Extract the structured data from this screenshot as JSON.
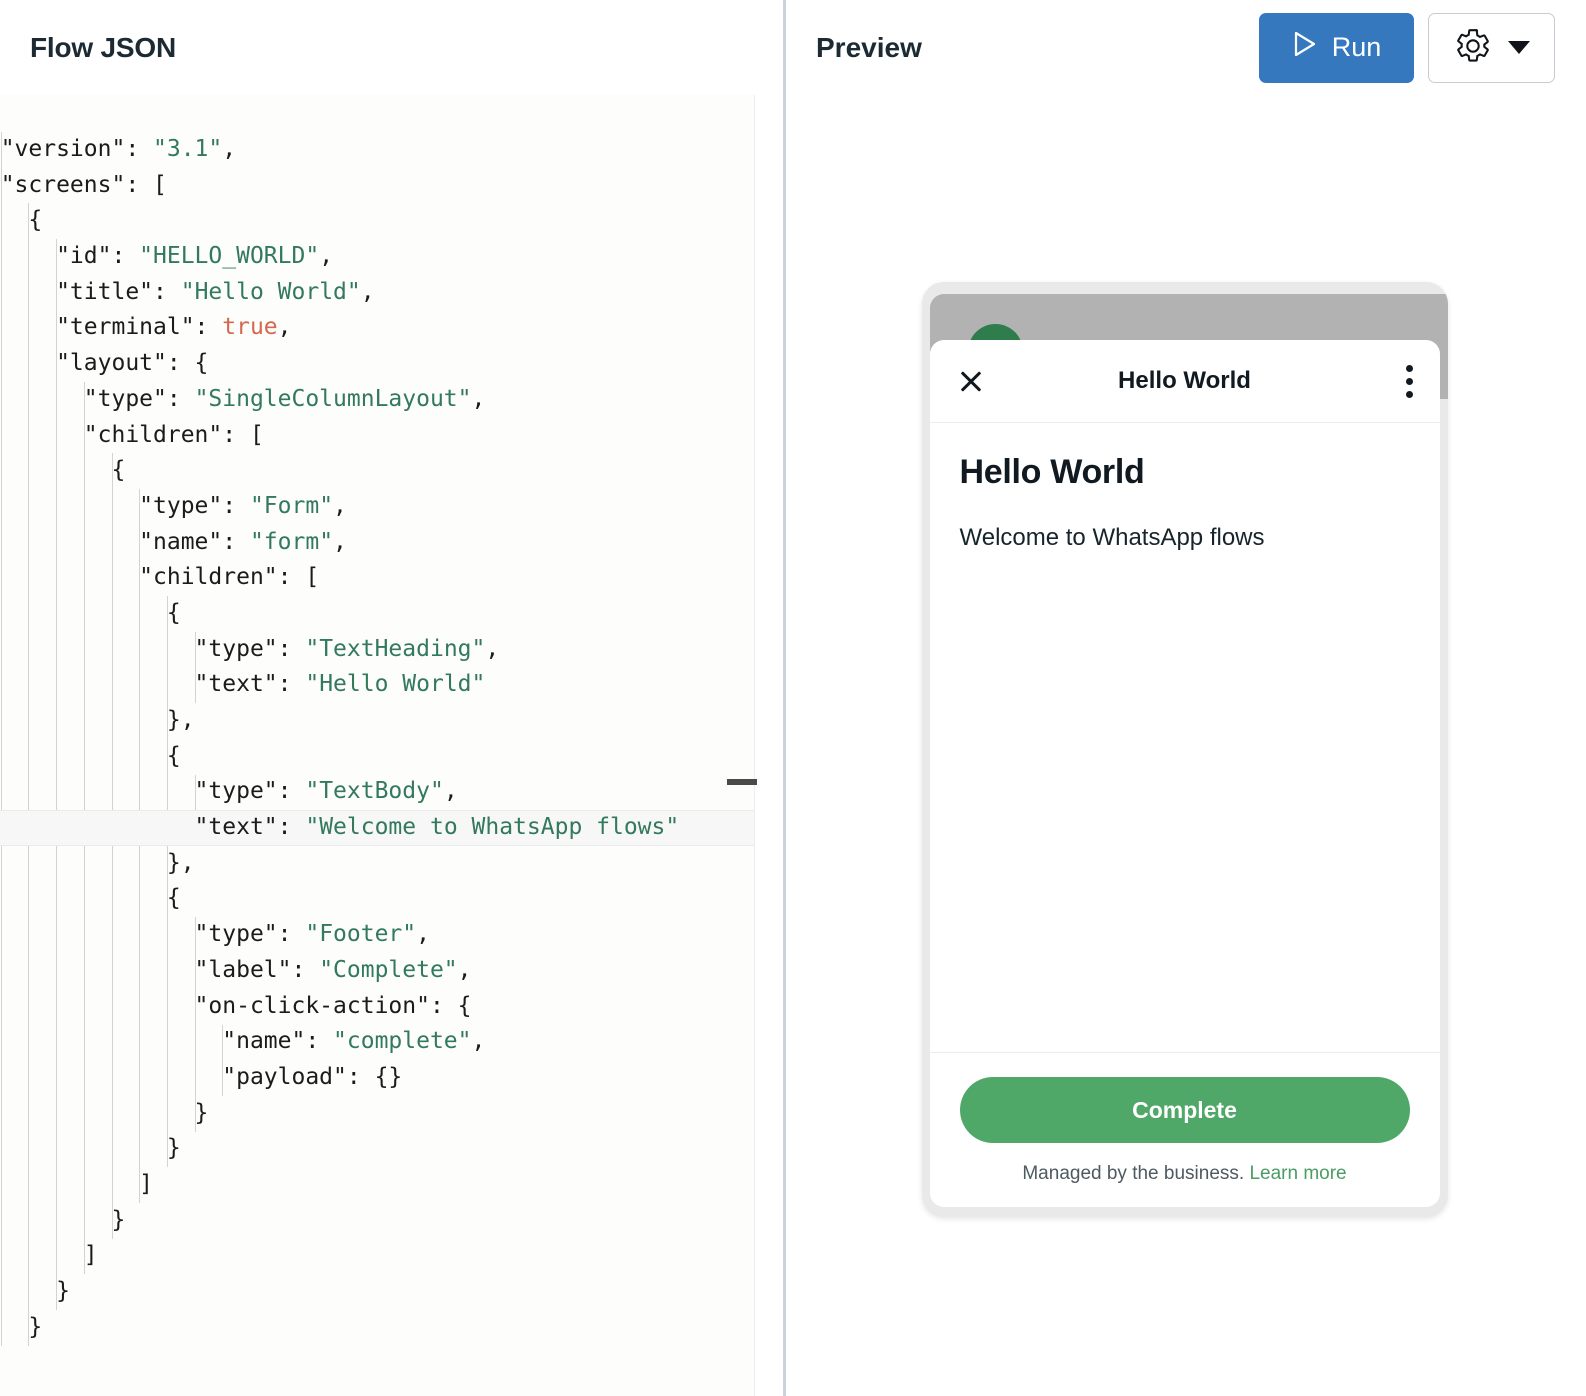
{
  "editor": {
    "title": "Flow JSON",
    "current_line_index": 19,
    "horizontal_scroll_chars": 3,
    "lines": [
      [
        {
          "t": "  \"version\": ",
          "c": "k"
        },
        {
          "t": "\"3.1\"",
          "c": "s"
        },
        {
          "t": ",",
          "c": "k"
        }
      ],
      [
        {
          "t": "  \"screens\": [",
          "c": "k"
        }
      ],
      [
        {
          "t": "    {",
          "c": "k"
        }
      ],
      [
        {
          "t": "      \"id\": ",
          "c": "k"
        },
        {
          "t": "\"HELLO_WORLD\"",
          "c": "s"
        },
        {
          "t": ",",
          "c": "k"
        }
      ],
      [
        {
          "t": "      \"title\": ",
          "c": "k"
        },
        {
          "t": "\"Hello World\"",
          "c": "s"
        },
        {
          "t": ",",
          "c": "k"
        }
      ],
      [
        {
          "t": "      \"terminal\": ",
          "c": "k"
        },
        {
          "t": "true",
          "c": "b"
        },
        {
          "t": ",",
          "c": "k"
        }
      ],
      [
        {
          "t": "      \"layout\": {",
          "c": "k"
        }
      ],
      [
        {
          "t": "        \"type\": ",
          "c": "k"
        },
        {
          "t": "\"SingleColumnLayout\"",
          "c": "s"
        },
        {
          "t": ",",
          "c": "k"
        }
      ],
      [
        {
          "t": "        \"children\": [",
          "c": "k"
        }
      ],
      [
        {
          "t": "          {",
          "c": "k"
        }
      ],
      [
        {
          "t": "            \"type\": ",
          "c": "k"
        },
        {
          "t": "\"Form\"",
          "c": "s"
        },
        {
          "t": ",",
          "c": "k"
        }
      ],
      [
        {
          "t": "            \"name\": ",
          "c": "k"
        },
        {
          "t": "\"form\"",
          "c": "s"
        },
        {
          "t": ",",
          "c": "k"
        }
      ],
      [
        {
          "t": "            \"children\": [",
          "c": "k"
        }
      ],
      [
        {
          "t": "              {",
          "c": "k"
        }
      ],
      [
        {
          "t": "                \"type\": ",
          "c": "k"
        },
        {
          "t": "\"TextHeading\"",
          "c": "s"
        },
        {
          "t": ",",
          "c": "k"
        }
      ],
      [
        {
          "t": "                \"text\": ",
          "c": "k"
        },
        {
          "t": "\"Hello World\"",
          "c": "s"
        }
      ],
      [
        {
          "t": "              },",
          "c": "k"
        }
      ],
      [
        {
          "t": "              {",
          "c": "k"
        }
      ],
      [
        {
          "t": "                \"type\": ",
          "c": "k"
        },
        {
          "t": "\"TextBody\"",
          "c": "s"
        },
        {
          "t": ",",
          "c": "k"
        }
      ],
      [
        {
          "t": "                \"text\": ",
          "c": "k"
        },
        {
          "t": "\"Welcome to WhatsApp flows\"",
          "c": "s"
        }
      ],
      [
        {
          "t": "              },",
          "c": "k"
        }
      ],
      [
        {
          "t": "              {",
          "c": "k"
        }
      ],
      [
        {
          "t": "                \"type\": ",
          "c": "k"
        },
        {
          "t": "\"Footer\"",
          "c": "s"
        },
        {
          "t": ",",
          "c": "k"
        }
      ],
      [
        {
          "t": "                \"label\": ",
          "c": "k"
        },
        {
          "t": "\"Complete\"",
          "c": "s"
        },
        {
          "t": ",",
          "c": "k"
        }
      ],
      [
        {
          "t": "                \"on-click-action\": {",
          "c": "k"
        }
      ],
      [
        {
          "t": "                  \"name\": ",
          "c": "k"
        },
        {
          "t": "\"complete\"",
          "c": "s"
        },
        {
          "t": ",",
          "c": "k"
        }
      ],
      [
        {
          "t": "                  \"payload\": {}",
          "c": "k"
        }
      ],
      [
        {
          "t": "                }",
          "c": "k"
        }
      ],
      [
        {
          "t": "              }",
          "c": "k"
        }
      ],
      [
        {
          "t": "            ]",
          "c": "k"
        }
      ],
      [
        {
          "t": "          }",
          "c": "k"
        }
      ],
      [
        {
          "t": "        ]",
          "c": "k"
        }
      ],
      [
        {
          "t": "      }",
          "c": "k"
        }
      ],
      [
        {
          "t": "    }",
          "c": "k"
        }
      ]
    ],
    "colors": {
      "string": "#33795c",
      "key": "#1b1b1b",
      "boolean": "#d4694e",
      "current_line_bg": "#f7f7f7"
    }
  },
  "preview": {
    "title": "Preview",
    "run_label": "Run",
    "run_icon": "play-triangle-icon",
    "run_color": "#3578bd",
    "settings_icon": "gear-icon",
    "settings_caret_icon": "chevron-down-icon"
  },
  "device": {
    "header": {
      "close_icon": "close-icon",
      "title": "Hello World",
      "menu_icon": "kebab-menu-icon"
    },
    "body": {
      "heading": "Hello World",
      "text": "Welcome to WhatsApp flows"
    },
    "footer": {
      "button_label": "Complete",
      "button_color": "#4fa868",
      "managed_text": "Managed by the business.",
      "learn_more_label": "Learn more",
      "learn_more_color": "#4a9c63"
    },
    "avatar_color": "#2f7d4d",
    "chat_bar_color": "#b2b2b2"
  }
}
